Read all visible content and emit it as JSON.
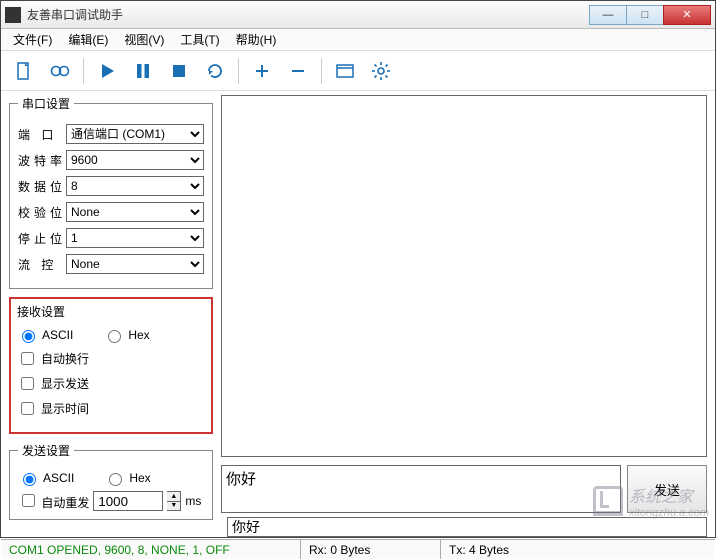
{
  "window": {
    "title": "友善串口调试助手"
  },
  "menu": {
    "file": "文件(F)",
    "edit": "编辑(E)",
    "view": "视图(V)",
    "tools": "工具(T)",
    "help": "帮助(H)"
  },
  "toolbar_icons": {
    "new": "new-file-icon",
    "record": "record-icon",
    "play": "play-icon",
    "pause": "pause-icon",
    "stop": "stop-icon",
    "reload": "reload-icon",
    "plus": "plus-icon",
    "minus": "minus-icon",
    "window": "window-icon",
    "gear": "gear-icon"
  },
  "serial": {
    "legend": "串口设置",
    "port_label": "端 口",
    "port_value": "通信端口 (COM1)",
    "baud_label": "波特率",
    "baud_value": "9600",
    "databits_label": "数据位",
    "databits_value": "8",
    "parity_label": "校验位",
    "parity_value": "None",
    "stopbits_label": "停止位",
    "stopbits_value": "1",
    "flow_label": "流 控",
    "flow_value": "None"
  },
  "recv": {
    "legend": "接收设置",
    "ascii": "ASCII",
    "hex": "Hex",
    "autowrap": "自动换行",
    "showsend": "显示发送",
    "showtime": "显示时间",
    "ascii_selected": true,
    "hex_selected": false,
    "autowrap_checked": false,
    "showsend_checked": false,
    "showtime_checked": false
  },
  "sendset": {
    "legend": "发送设置",
    "ascii": "ASCII",
    "hex": "Hex",
    "auto_resend": "自动重发",
    "interval_value": "1000",
    "interval_unit": "ms",
    "ascii_selected": true,
    "hex_selected": false,
    "auto_checked": false
  },
  "sendbox": {
    "text": "你好",
    "button": "发送"
  },
  "cmdline": {
    "value": "你好"
  },
  "status": {
    "conn": "COM1 OPENED, 9600, 8, NONE, 1, OFF",
    "rx": "Rx: 0 Bytes",
    "tx": "Tx: 4 Bytes"
  },
  "watermark": {
    "text1": "系统之家",
    "text2": "xitongzhu.a.com"
  }
}
